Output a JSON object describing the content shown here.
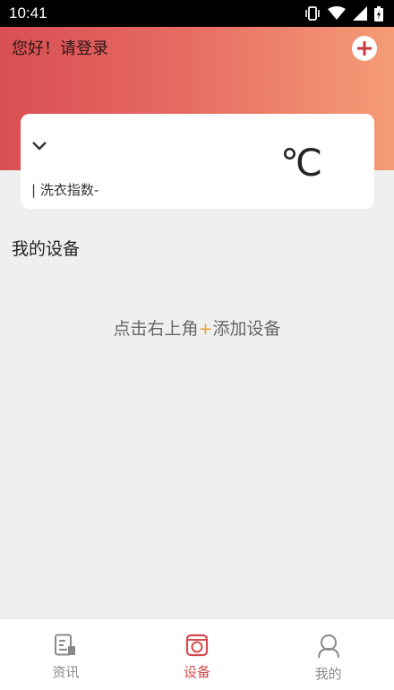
{
  "status_bar": {
    "time": "10:41",
    "icons": [
      "vibrate-icon",
      "wifi-icon",
      "signal-icon",
      "battery-icon"
    ]
  },
  "header": {
    "greeting": "您好！请登录",
    "add_icon": "plus-circle-icon",
    "gradient_colors": [
      "#d94e52",
      "#f59c76"
    ]
  },
  "weather_card": {
    "location_icon": "chevron-down-icon",
    "temperature_unit": "℃",
    "laundry_index": "| 洗衣指数-"
  },
  "devices": {
    "title": "我的设备",
    "empty_hint_prefix": "点击右上角",
    "empty_hint_plus": "+",
    "empty_hint_suffix": "添加设备",
    "plus_color": "#e8a12a"
  },
  "bottom_nav": {
    "items": [
      {
        "label": "资讯",
        "icon": "news-icon",
        "active": false
      },
      {
        "label": "设备",
        "icon": "device-icon",
        "active": true
      },
      {
        "label": "我的",
        "icon": "profile-icon",
        "active": false
      }
    ],
    "active_color": "#d24c4f",
    "inactive_color": "#8a8a8a"
  }
}
